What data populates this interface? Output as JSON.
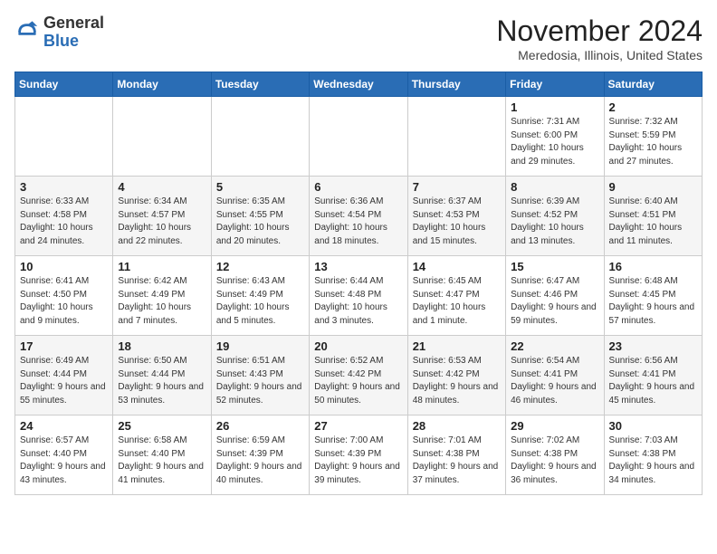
{
  "app": {
    "name_general": "General",
    "name_blue": "Blue",
    "month_title": "November 2024",
    "location": "Meredosia, Illinois, United States"
  },
  "weekdays": [
    "Sunday",
    "Monday",
    "Tuesday",
    "Wednesday",
    "Thursday",
    "Friday",
    "Saturday"
  ],
  "weeks": [
    [
      {
        "day": "",
        "info": ""
      },
      {
        "day": "",
        "info": ""
      },
      {
        "day": "",
        "info": ""
      },
      {
        "day": "",
        "info": ""
      },
      {
        "day": "",
        "info": ""
      },
      {
        "day": "1",
        "info": "Sunrise: 7:31 AM\nSunset: 6:00 PM\nDaylight: 10 hours\nand 29 minutes."
      },
      {
        "day": "2",
        "info": "Sunrise: 7:32 AM\nSunset: 5:59 PM\nDaylight: 10 hours\nand 27 minutes."
      }
    ],
    [
      {
        "day": "3",
        "info": "Sunrise: 6:33 AM\nSunset: 4:58 PM\nDaylight: 10 hours\nand 24 minutes."
      },
      {
        "day": "4",
        "info": "Sunrise: 6:34 AM\nSunset: 4:57 PM\nDaylight: 10 hours\nand 22 minutes."
      },
      {
        "day": "5",
        "info": "Sunrise: 6:35 AM\nSunset: 4:55 PM\nDaylight: 10 hours\nand 20 minutes."
      },
      {
        "day": "6",
        "info": "Sunrise: 6:36 AM\nSunset: 4:54 PM\nDaylight: 10 hours\nand 18 minutes."
      },
      {
        "day": "7",
        "info": "Sunrise: 6:37 AM\nSunset: 4:53 PM\nDaylight: 10 hours\nand 15 minutes."
      },
      {
        "day": "8",
        "info": "Sunrise: 6:39 AM\nSunset: 4:52 PM\nDaylight: 10 hours\nand 13 minutes."
      },
      {
        "day": "9",
        "info": "Sunrise: 6:40 AM\nSunset: 4:51 PM\nDaylight: 10 hours\nand 11 minutes."
      }
    ],
    [
      {
        "day": "10",
        "info": "Sunrise: 6:41 AM\nSunset: 4:50 PM\nDaylight: 10 hours\nand 9 minutes."
      },
      {
        "day": "11",
        "info": "Sunrise: 6:42 AM\nSunset: 4:49 PM\nDaylight: 10 hours\nand 7 minutes."
      },
      {
        "day": "12",
        "info": "Sunrise: 6:43 AM\nSunset: 4:49 PM\nDaylight: 10 hours\nand 5 minutes."
      },
      {
        "day": "13",
        "info": "Sunrise: 6:44 AM\nSunset: 4:48 PM\nDaylight: 10 hours\nand 3 minutes."
      },
      {
        "day": "14",
        "info": "Sunrise: 6:45 AM\nSunset: 4:47 PM\nDaylight: 10 hours\nand 1 minute."
      },
      {
        "day": "15",
        "info": "Sunrise: 6:47 AM\nSunset: 4:46 PM\nDaylight: 9 hours\nand 59 minutes."
      },
      {
        "day": "16",
        "info": "Sunrise: 6:48 AM\nSunset: 4:45 PM\nDaylight: 9 hours\nand 57 minutes."
      }
    ],
    [
      {
        "day": "17",
        "info": "Sunrise: 6:49 AM\nSunset: 4:44 PM\nDaylight: 9 hours\nand 55 minutes."
      },
      {
        "day": "18",
        "info": "Sunrise: 6:50 AM\nSunset: 4:44 PM\nDaylight: 9 hours\nand 53 minutes."
      },
      {
        "day": "19",
        "info": "Sunrise: 6:51 AM\nSunset: 4:43 PM\nDaylight: 9 hours\nand 52 minutes."
      },
      {
        "day": "20",
        "info": "Sunrise: 6:52 AM\nSunset: 4:42 PM\nDaylight: 9 hours\nand 50 minutes."
      },
      {
        "day": "21",
        "info": "Sunrise: 6:53 AM\nSunset: 4:42 PM\nDaylight: 9 hours\nand 48 minutes."
      },
      {
        "day": "22",
        "info": "Sunrise: 6:54 AM\nSunset: 4:41 PM\nDaylight: 9 hours\nand 46 minutes."
      },
      {
        "day": "23",
        "info": "Sunrise: 6:56 AM\nSunset: 4:41 PM\nDaylight: 9 hours\nand 45 minutes."
      }
    ],
    [
      {
        "day": "24",
        "info": "Sunrise: 6:57 AM\nSunset: 4:40 PM\nDaylight: 9 hours\nand 43 minutes."
      },
      {
        "day": "25",
        "info": "Sunrise: 6:58 AM\nSunset: 4:40 PM\nDaylight: 9 hours\nand 41 minutes."
      },
      {
        "day": "26",
        "info": "Sunrise: 6:59 AM\nSunset: 4:39 PM\nDaylight: 9 hours\nand 40 minutes."
      },
      {
        "day": "27",
        "info": "Sunrise: 7:00 AM\nSunset: 4:39 PM\nDaylight: 9 hours\nand 39 minutes."
      },
      {
        "day": "28",
        "info": "Sunrise: 7:01 AM\nSunset: 4:38 PM\nDaylight: 9 hours\nand 37 minutes."
      },
      {
        "day": "29",
        "info": "Sunrise: 7:02 AM\nSunset: 4:38 PM\nDaylight: 9 hours\nand 36 minutes."
      },
      {
        "day": "30",
        "info": "Sunrise: 7:03 AM\nSunset: 4:38 PM\nDaylight: 9 hours\nand 34 minutes."
      }
    ]
  ]
}
